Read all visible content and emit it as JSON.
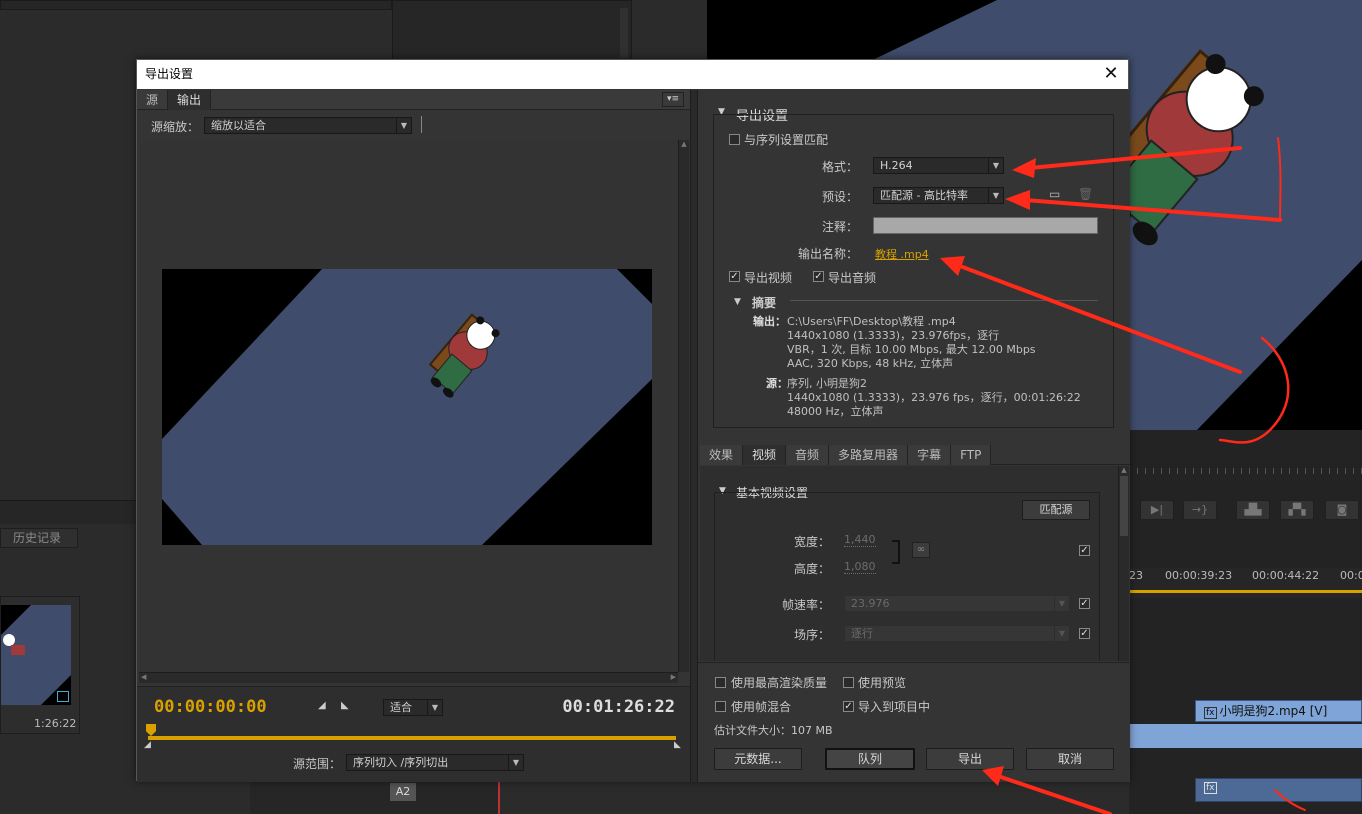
{
  "background": {
    "history_tab": "历史记录",
    "clip_duration": "1:26:22",
    "timecodes": [
      "23",
      "00:00:39:23",
      "00:00:44:22",
      "00:0"
    ],
    "clip_video": "小明是狗2.mp4 [V]",
    "track_a2": "A2"
  },
  "dialog": {
    "title": "导出设置",
    "tabs": [
      "源",
      "输出"
    ],
    "source_scale_label": "源缩放：",
    "source_scale_value": "缩放以适合",
    "current_time": "00:00:00:00",
    "fit_value": "适合",
    "duration": "00:01:26:22",
    "source_range_label": "源范围：",
    "source_range_value": "序列切入 /序列切出",
    "export_settings": {
      "heading": "导出设置",
      "match_sequence": "与序列设置匹配",
      "format_label": "格式：",
      "format_value": "H.264",
      "preset_label": "预设：",
      "preset_value": "匹配源 - 高比特率",
      "comment_label": "注释：",
      "output_name_label": "输出名称：",
      "output_name_value": "教程 .mp4",
      "export_video": "导出视频",
      "export_audio": "导出音频",
      "summary_heading": "摘要",
      "output_label": "输出：",
      "output_lines": [
        "C:\\Users\\FF\\Desktop\\教程 .mp4",
        "1440x1080  (1.3333)，23.976fps，逐行",
        "VBR，1 次, 目标  10.00 Mbps, 最大  12.00 Mbps",
        "AAC, 320 Kbps, 48  kHz, 立体声"
      ],
      "source_label": "源：",
      "source_lines": [
        "序列, 小明是狗2",
        "1440x1080  (1.3333)，23.976 fps，逐行，00:01:26:22",
        "48000 Hz，立体声"
      ]
    },
    "settings_tabs": [
      "效果",
      "视频",
      "音频",
      "多路复用器",
      "字幕",
      "FTP"
    ],
    "video": {
      "heading": "基本视频设置",
      "match_source": "匹配源",
      "width_label": "宽度：",
      "width_value": "1,440",
      "height_label": "高度：",
      "height_value": "1,080",
      "frame_rate_label": "帧速率：",
      "frame_rate_value": "23.976",
      "field_order_label": "场序：",
      "field_order_value": "逐行"
    },
    "options": {
      "max_render_quality": "使用最高渲染质量",
      "use_previews": "使用预览",
      "frame_blending": "使用帧混合",
      "import_into_project": "导入到项目中",
      "estimated_size": "估计文件大小：107 MB"
    },
    "buttons": {
      "metadata": "元数据...",
      "queue": "队列",
      "export": "导出",
      "cancel": "取消"
    }
  },
  "colors": {
    "accent_gold": "#d9a100",
    "annotation_red": "#ff2a1a",
    "preview_blue": "#3f4c6b"
  }
}
